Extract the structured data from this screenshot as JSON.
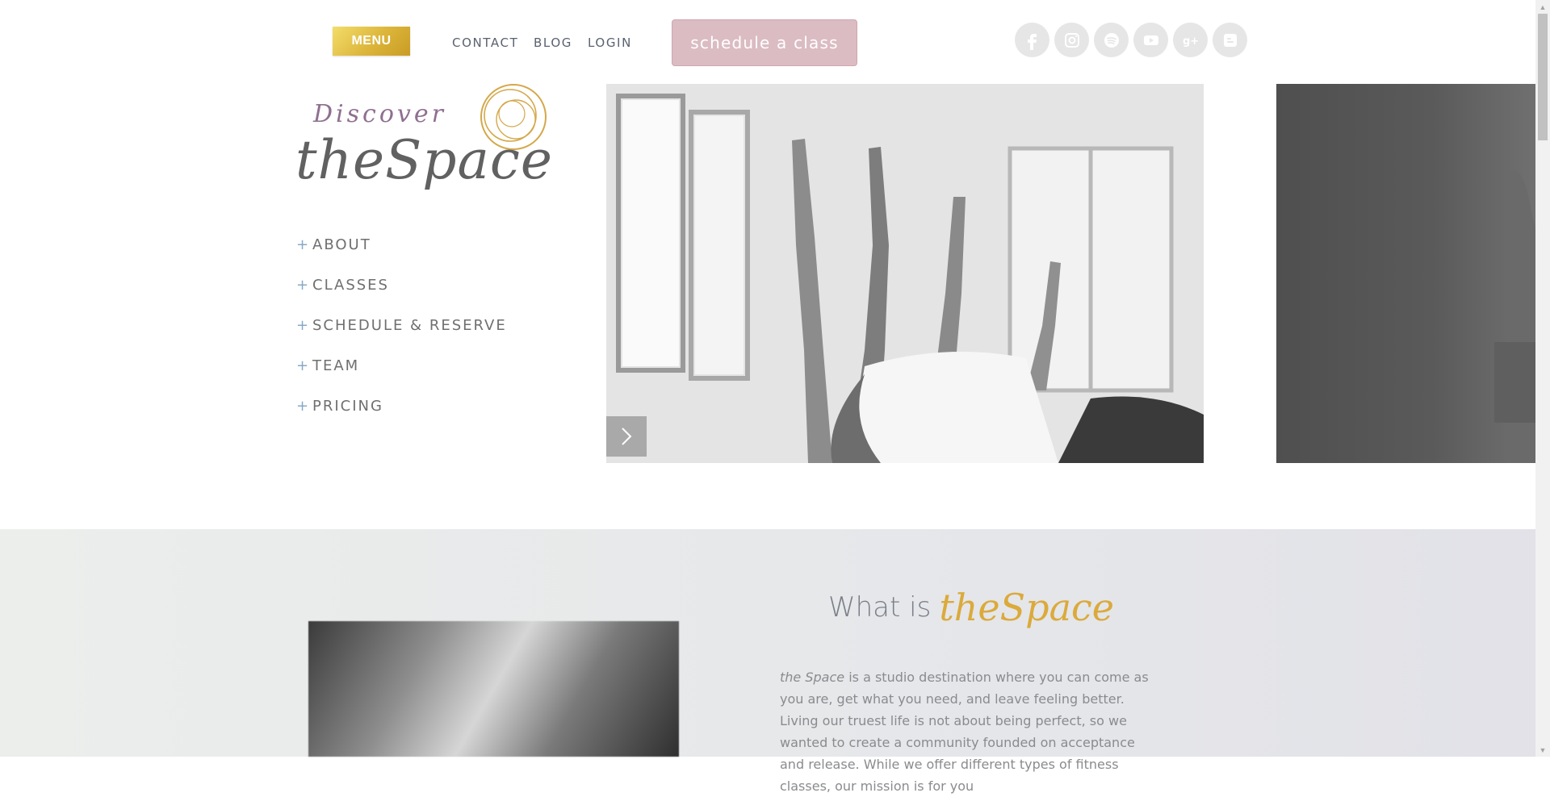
{
  "header": {
    "menu_label": "MENU",
    "links": [
      "CONTACT",
      "BLOG",
      "LOGIN"
    ],
    "cta_label": "schedule a class",
    "social_icons": [
      "facebook-icon",
      "instagram-icon",
      "spotify-icon",
      "youtube-icon",
      "google-plus-icon",
      "blogger-icon"
    ]
  },
  "logo": {
    "line1": "Discover",
    "line2": "theSpace"
  },
  "sidebar": {
    "items": [
      {
        "label": "ABOUT"
      },
      {
        "label": "CLASSES"
      },
      {
        "label": "SCHEDULE & RESERVE"
      },
      {
        "label": "TEAM"
      },
      {
        "label": "PRICING"
      }
    ]
  },
  "about": {
    "title_plain": "What is",
    "title_script": "theSpace",
    "brand_italic": "the Space",
    "body": " is a studio destination where you can come as you are, get what you need, and leave feeling better. Living our truest life is not about being perfect, so we wanted to create a community founded on acceptance and release. While we offer different types of fitness classes, our mission is for you"
  },
  "colors": {
    "accent_gold": "#dbaa3b",
    "cta_pink": "#dbbcc3",
    "nav_plus": "#87a9c8"
  }
}
